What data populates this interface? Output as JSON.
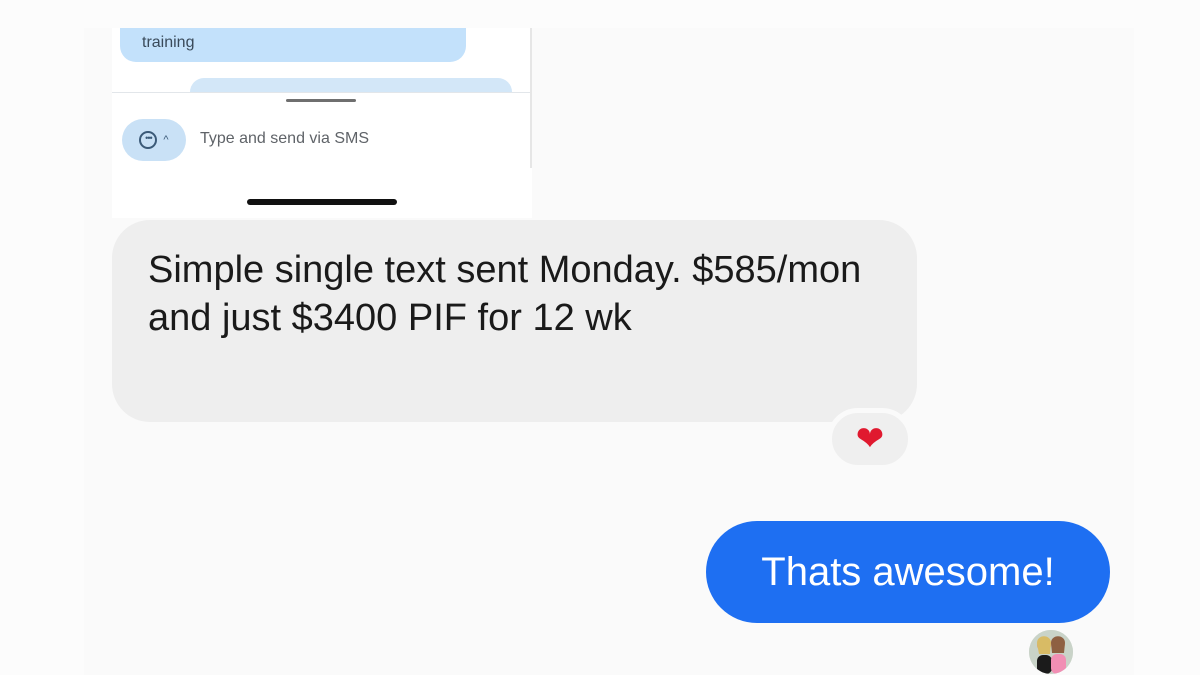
{
  "embedded_screenshot": {
    "previous_message": "training",
    "composer": {
      "placeholder": "Type and send via SMS"
    }
  },
  "messages": {
    "incoming": {
      "text": "Simple single text sent Monday. $585/mon and just $3400 PIF for 12 wk",
      "reaction": "❤"
    },
    "outgoing": {
      "text": "Thats awesome!"
    }
  },
  "colors": {
    "incoming_bubble": "#eeeeee",
    "outgoing_bubble": "#1e6ff2",
    "embed_bubble": "#c3e1fb",
    "reaction_heart": "#e0192f"
  },
  "icons": {
    "composer_toggle": "chat-bubble-icon",
    "composer_caret": "chevron-up-icon",
    "reaction": "heart-icon"
  }
}
